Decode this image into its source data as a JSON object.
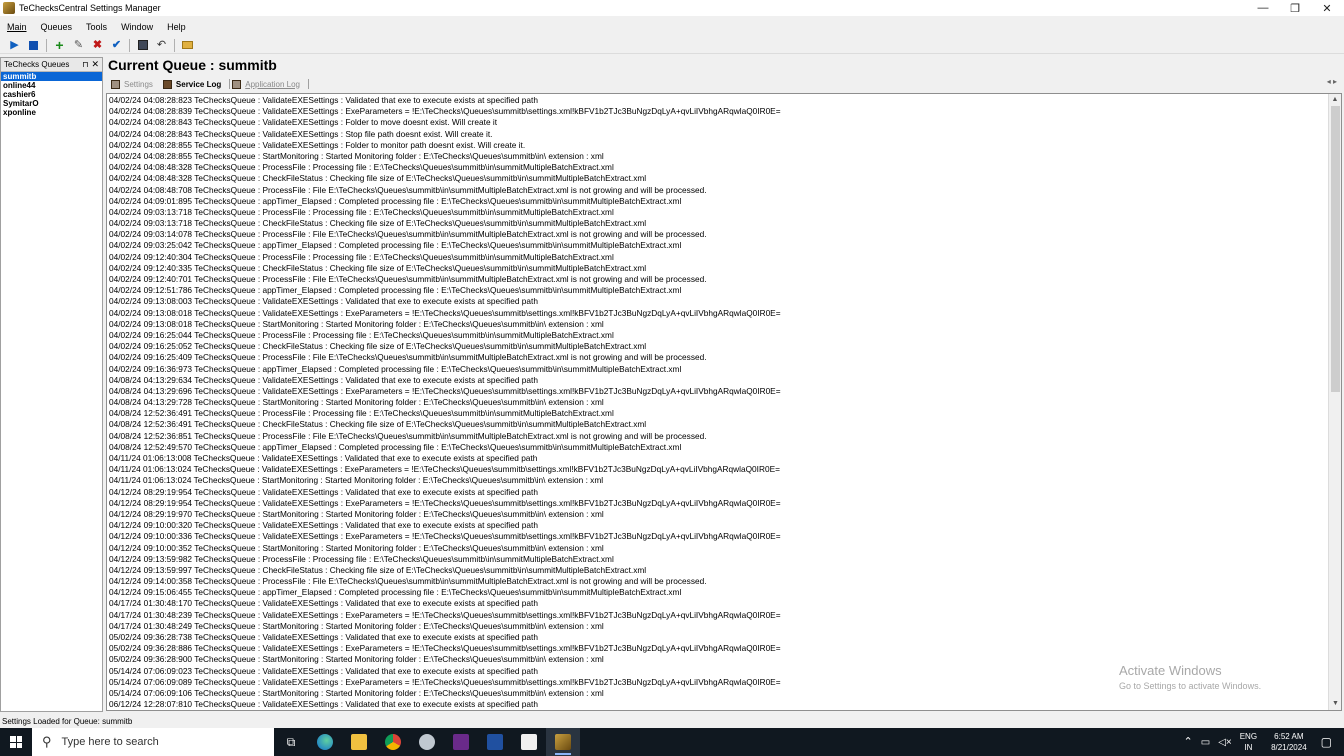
{
  "window": {
    "title": "TeChecksCentral Settings Manager"
  },
  "menu": [
    "Main",
    "Queues",
    "Tools",
    "Window",
    "Help"
  ],
  "panel": {
    "title": "TeChecks Queues",
    "queues": [
      "summitb",
      "online44",
      "cashier6",
      "SymitarO",
      "xponline"
    ]
  },
  "main": {
    "title": "Current Queue : summitb",
    "tabs": [
      "Settings",
      "Service Log",
      "Application Log"
    ],
    "log": [
      "04/02/24 04:08:28:823 TeChecksQueue : ValidateEXESettings : Validated that exe to execute exists at specified path",
      "04/02/24 04:08:28:839 TeChecksQueue : ValidateEXESettings : ExeParameters = !E:\\TeChecks\\Queues\\summitb\\settings.xml!kBFV1b2TJc3BuNgzDqLyA+qvLiIVbhgARqwlaQ0IR0E=",
      "04/02/24 04:08:28:843 TeChecksQueue : ValidateEXESettings : Folder to move doesnt exist. Will create it",
      "04/02/24 04:08:28:843 TeChecksQueue : ValidateEXESettings : Stop file path doesnt exist. Will create it.",
      "04/02/24 04:08:28:855 TeChecksQueue : ValidateEXESettings : Folder to monitor path doesnt exist. Will create it.",
      "04/02/24 04:08:28:855 TeChecksQueue : StartMonitoring : Started Monitoring folder : E:\\TeChecks\\Queues\\summitb\\in\\ extension : xml",
      "04/02/24 04:08:48:328 TeChecksQueue : ProcessFile : Processing file : E:\\TeChecks\\Queues\\summitb\\in\\summitMultipleBatchExtract.xml",
      "04/02/24 04:08:48:328 TeChecksQueue : CheckFileStatus : Checking file size of E:\\TeChecks\\Queues\\summitb\\in\\summitMultipleBatchExtract.xml",
      "04/02/24 04:08:48:708 TeChecksQueue : ProcessFile : File E:\\TeChecks\\Queues\\summitb\\in\\summitMultipleBatchExtract.xml is not growing and will be processed.",
      "04/02/24 04:09:01:895 TeChecksQueue : appTimer_Elapsed : Completed processing file : E:\\TeChecks\\Queues\\summitb\\in\\summitMultipleBatchExtract.xml",
      "04/02/24 09:03:13:718 TeChecksQueue : ProcessFile : Processing file : E:\\TeChecks\\Queues\\summitb\\in\\summitMultipleBatchExtract.xml",
      "04/02/24 09:03:13:718 TeChecksQueue : CheckFileStatus : Checking file size of E:\\TeChecks\\Queues\\summitb\\in\\summitMultipleBatchExtract.xml",
      "04/02/24 09:03:14:078 TeChecksQueue : ProcessFile : File E:\\TeChecks\\Queues\\summitb\\in\\summitMultipleBatchExtract.xml is not growing and will be processed.",
      "04/02/24 09:03:25:042 TeChecksQueue : appTimer_Elapsed : Completed processing file : E:\\TeChecks\\Queues\\summitb\\in\\summitMultipleBatchExtract.xml",
      "04/02/24 09:12:40:304 TeChecksQueue : ProcessFile : Processing file : E:\\TeChecks\\Queues\\summitb\\in\\summitMultipleBatchExtract.xml",
      "04/02/24 09:12:40:335 TeChecksQueue : CheckFileStatus : Checking file size of E:\\TeChecks\\Queues\\summitb\\in\\summitMultipleBatchExtract.xml",
      "04/02/24 09:12:40:701 TeChecksQueue : ProcessFile : File E:\\TeChecks\\Queues\\summitb\\in\\summitMultipleBatchExtract.xml is not growing and will be processed.",
      "04/02/24 09:12:51:786 TeChecksQueue : appTimer_Elapsed : Completed processing file : E:\\TeChecks\\Queues\\summitb\\in\\summitMultipleBatchExtract.xml",
      "04/02/24 09:13:08:003 TeChecksQueue : ValidateEXESettings : Validated that exe to execute exists at specified path",
      "04/02/24 09:13:08:018 TeChecksQueue : ValidateEXESettings : ExeParameters = !E:\\TeChecks\\Queues\\summitb\\settings.xml!kBFV1b2TJc3BuNgzDqLyA+qvLiIVbhgARqwlaQ0IR0E=",
      "04/02/24 09:13:08:018 TeChecksQueue : StartMonitoring : Started Monitoring folder : E:\\TeChecks\\Queues\\summitb\\in\\ extension : xml",
      "04/02/24 09:16:25:044 TeChecksQueue : ProcessFile : Processing file : E:\\TeChecks\\Queues\\summitb\\in\\summitMultipleBatchExtract.xml",
      "04/02/24 09:16:25:052 TeChecksQueue : CheckFileStatus : Checking file size of E:\\TeChecks\\Queues\\summitb\\in\\summitMultipleBatchExtract.xml",
      "04/02/24 09:16:25:409 TeChecksQueue : ProcessFile : File E:\\TeChecks\\Queues\\summitb\\in\\summitMultipleBatchExtract.xml is not growing and will be processed.",
      "04/02/24 09:16:36:973 TeChecksQueue : appTimer_Elapsed : Completed processing file : E:\\TeChecks\\Queues\\summitb\\in\\summitMultipleBatchExtract.xml",
      "04/08/24 04:13:29:634 TeChecksQueue : ValidateEXESettings : Validated that exe to execute exists at specified path",
      "04/08/24 04:13:29:696 TeChecksQueue : ValidateEXESettings : ExeParameters = !E:\\TeChecks\\Queues\\summitb\\settings.xml!kBFV1b2TJc3BuNgzDqLyA+qvLiIVbhgARqwlaQ0IR0E=",
      "04/08/24 04:13:29:728 TeChecksQueue : StartMonitoring : Started Monitoring folder : E:\\TeChecks\\Queues\\summitb\\in\\ extension : xml",
      "04/08/24 12:52:36:491 TeChecksQueue : ProcessFile : Processing file : E:\\TeChecks\\Queues\\summitb\\in\\summitMultipleBatchExtract.xml",
      "04/08/24 12:52:36:491 TeChecksQueue : CheckFileStatus : Checking file size of E:\\TeChecks\\Queues\\summitb\\in\\summitMultipleBatchExtract.xml",
      "04/08/24 12:52:36:851 TeChecksQueue : ProcessFile : File E:\\TeChecks\\Queues\\summitb\\in\\summitMultipleBatchExtract.xml is not growing and will be processed.",
      "04/08/24 12:52:49:570 TeChecksQueue : appTimer_Elapsed : Completed processing file : E:\\TeChecks\\Queues\\summitb\\in\\summitMultipleBatchExtract.xml",
      "04/11/24 01:06:13:008 TeChecksQueue : ValidateEXESettings : Validated that exe to execute exists at specified path",
      "04/11/24 01:06:13:024 TeChecksQueue : ValidateEXESettings : ExeParameters = !E:\\TeChecks\\Queues\\summitb\\settings.xml!kBFV1b2TJc3BuNgzDqLyA+qvLiIVbhgARqwlaQ0IR0E=",
      "04/11/24 01:06:13:024 TeChecksQueue : StartMonitoring : Started Monitoring folder : E:\\TeChecks\\Queues\\summitb\\in\\ extension : xml",
      "04/12/24 08:29:19:954 TeChecksQueue : ValidateEXESettings : Validated that exe to execute exists at specified path",
      "04/12/24 08:29:19:954 TeChecksQueue : ValidateEXESettings : ExeParameters = !E:\\TeChecks\\Queues\\summitb\\settings.xml!kBFV1b2TJc3BuNgzDqLyA+qvLiIVbhgARqwlaQ0IR0E=",
      "04/12/24 08:29:19:970 TeChecksQueue : StartMonitoring : Started Monitoring folder : E:\\TeChecks\\Queues\\summitb\\in\\ extension : xml",
      "04/12/24 09:10:00:320 TeChecksQueue : ValidateEXESettings : Validated that exe to execute exists at specified path",
      "04/12/24 09:10:00:336 TeChecksQueue : ValidateEXESettings : ExeParameters = !E:\\TeChecks\\Queues\\summitb\\settings.xml!kBFV1b2TJc3BuNgzDqLyA+qvLiIVbhgARqwlaQ0IR0E=",
      "04/12/24 09:10:00:352 TeChecksQueue : StartMonitoring : Started Monitoring folder : E:\\TeChecks\\Queues\\summitb\\in\\ extension : xml",
      "04/12/24 09:13:59:982 TeChecksQueue : ProcessFile : Processing file : E:\\TeChecks\\Queues\\summitb\\in\\summitMultipleBatchExtract.xml",
      "04/12/24 09:13:59:997 TeChecksQueue : CheckFileStatus : Checking file size of E:\\TeChecks\\Queues\\summitb\\in\\summitMultipleBatchExtract.xml",
      "04/12/24 09:14:00:358 TeChecksQueue : ProcessFile : File E:\\TeChecks\\Queues\\summitb\\in\\summitMultipleBatchExtract.xml is not growing and will be processed.",
      "04/12/24 09:15:06:455 TeChecksQueue : appTimer_Elapsed : Completed processing file : E:\\TeChecks\\Queues\\summitb\\in\\summitMultipleBatchExtract.xml",
      "04/17/24 01:30:48:170 TeChecksQueue : ValidateEXESettings : Validated that exe to execute exists at specified path",
      "04/17/24 01:30:48:239 TeChecksQueue : ValidateEXESettings : ExeParameters = !E:\\TeChecks\\Queues\\summitb\\settings.xml!kBFV1b2TJc3BuNgzDqLyA+qvLiIVbhgARqwlaQ0IR0E=",
      "04/17/24 01:30:48:249 TeChecksQueue : StartMonitoring : Started Monitoring folder : E:\\TeChecks\\Queues\\summitb\\in\\ extension : xml",
      "05/02/24 09:36:28:738 TeChecksQueue : ValidateEXESettings : Validated that exe to execute exists at specified path",
      "05/02/24 09:36:28:886 TeChecksQueue : ValidateEXESettings : ExeParameters = !E:\\TeChecks\\Queues\\summitb\\settings.xml!kBFV1b2TJc3BuNgzDqLyA+qvLiIVbhgARqwlaQ0IR0E=",
      "05/02/24 09:36:28:900 TeChecksQueue : StartMonitoring : Started Monitoring folder : E:\\TeChecks\\Queues\\summitb\\in\\ extension : xml",
      "05/14/24 07:06:09:023 TeChecksQueue : ValidateEXESettings : Validated that exe to execute exists at specified path",
      "05/14/24 07:06:09:089 TeChecksQueue : ValidateEXESettings : ExeParameters = !E:\\TeChecks\\Queues\\summitb\\settings.xml!kBFV1b2TJc3BuNgzDqLyA+qvLiIVbhgARqwlaQ0IR0E=",
      "05/14/24 07:06:09:106 TeChecksQueue : StartMonitoring : Started Monitoring folder : E:\\TeChecks\\Queues\\summitb\\in\\ extension : xml",
      "06/12/24 12:28:07:810 TeChecksQueue : ValidateEXESettings : Validated that exe to execute exists at specified path"
    ],
    "scroll_position": 0
  },
  "watermark": {
    "title": "Activate Windows",
    "subtitle": "Go to Settings to activate Windows."
  },
  "status": "Settings Loaded for Queue: summitb",
  "taskbar": {
    "search_placeholder": "Type here to search",
    "lang": "ENG",
    "region": "IN",
    "time": "6:52 AM",
    "date": "8/21/2024"
  },
  "colors": {
    "selection": "#0a66d6",
    "taskbar": "#101820"
  }
}
